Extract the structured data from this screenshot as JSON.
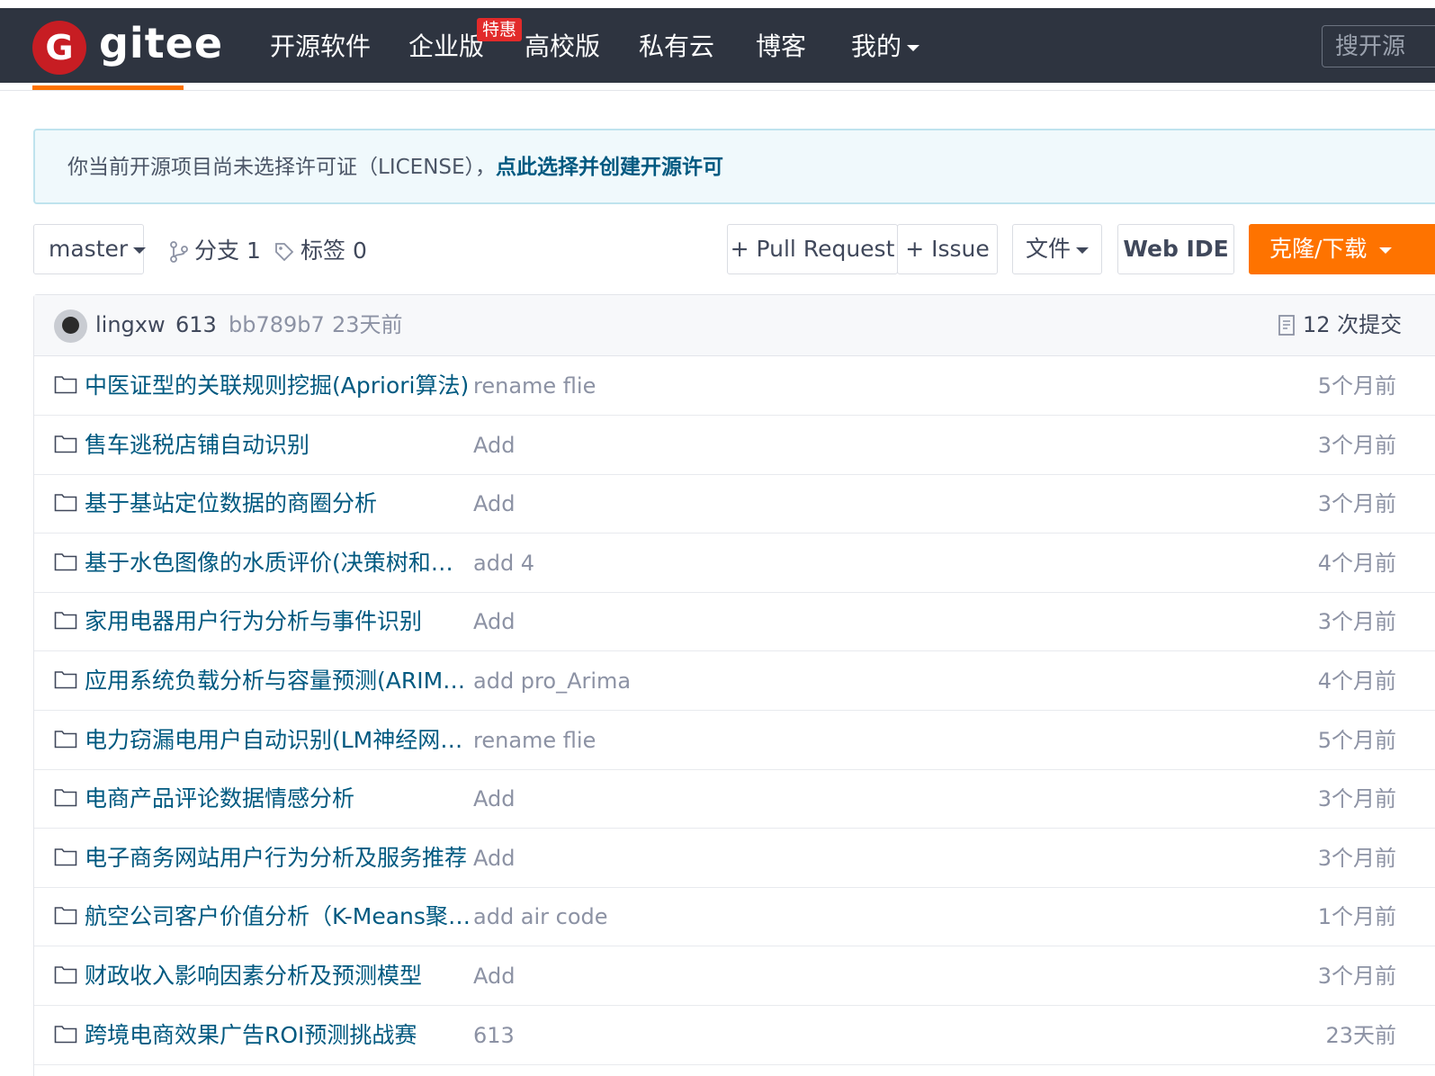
{
  "header": {
    "logo_letter": "G",
    "logo_text": "gitee",
    "nav": [
      "开源软件",
      "企业版",
      "高校版",
      "私有云",
      "博客",
      "我的"
    ],
    "badge": "特惠",
    "search_placeholder": "搜开源"
  },
  "notice": {
    "text": "你当前开源项目尚未选择许可证（LICENSE），",
    "link": "点此选择并创建开源许可"
  },
  "toolbar": {
    "branch": "master",
    "branches": "分支 1",
    "tags": "标签 0",
    "pull_request": "+ Pull Request",
    "issue": "+ Issue",
    "file": "文件",
    "web_ide": "Web IDE",
    "clone": "克隆/下载"
  },
  "commit": {
    "author": "lingxw",
    "message": "613",
    "hash": "bb789b7",
    "time": "23天前",
    "count": "12 次提交"
  },
  "files": [
    {
      "name": "中医证型的关联规则挖掘(Apriori算法)",
      "message": "rename flie",
      "time": "5个月前"
    },
    {
      "name": "售车逃税店铺自动识别",
      "message": "Add",
      "time": "3个月前"
    },
    {
      "name": "基于基站定位数据的商圈分析",
      "message": "Add",
      "time": "3个月前"
    },
    {
      "name": "基于水色图像的水质评价(决策树和图...",
      "message": "add 4",
      "time": "4个月前"
    },
    {
      "name": "家用电器用户行为分析与事件识别",
      "message": "Add",
      "time": "3个月前"
    },
    {
      "name": "应用系统负载分析与容量预测(ARIMA...",
      "message": "add pro_Arima",
      "time": "4个月前"
    },
    {
      "name": "电力窃漏电用户自动识别(LM神经网络...",
      "message": "rename flie",
      "time": "5个月前"
    },
    {
      "name": "电商产品评论数据情感分析",
      "message": "Add",
      "time": "3个月前"
    },
    {
      "name": "电子商务网站用户行为分析及服务推荐",
      "message": "Add",
      "time": "3个月前"
    },
    {
      "name": "航空公司客户价值分析（K-Means聚类...",
      "message": "add air code",
      "time": "1个月前"
    },
    {
      "name": "财政收入影响因素分析及预测模型",
      "message": "Add",
      "time": "3个月前"
    },
    {
      "name": "跨境电商效果广告ROI预测挑战赛",
      "message": "613",
      "time": "23天前"
    }
  ],
  "colors": {
    "navbar": "#2e3440",
    "accent": "#fe7300",
    "link": "#005980",
    "logo": "#c71d23"
  }
}
